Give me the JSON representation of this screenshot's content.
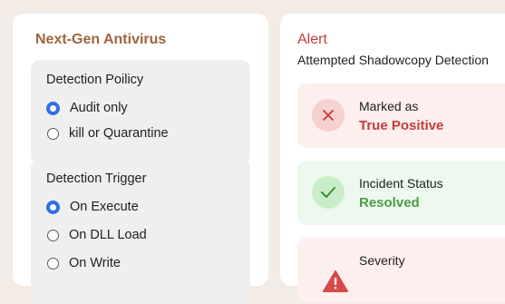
{
  "antivirus": {
    "title": "Next-Gen Antivirus",
    "policy": {
      "title": "Detection Poilicy",
      "options": [
        {
          "label": "Audit only",
          "selected": true
        },
        {
          "label": "kill or Quarantine",
          "selected": false
        }
      ]
    },
    "trigger": {
      "title": "Detection Trigger",
      "options": [
        {
          "label": "On Execute",
          "selected": true
        },
        {
          "label": "On DLL Load",
          "selected": false
        },
        {
          "label": "On Write",
          "selected": false
        }
      ]
    }
  },
  "alert": {
    "title": "Alert",
    "subtitle": "Attempted Shadowcopy Detection",
    "cards": [
      {
        "label": "Marked as",
        "value": "True Positive",
        "icon": "x-icon",
        "tone": "red"
      },
      {
        "label": "Incident Status",
        "value": "Resolved",
        "icon": "check-icon",
        "tone": "green"
      },
      {
        "label": "Severity",
        "value": "",
        "icon": "warning-icon",
        "tone": "red"
      }
    ]
  },
  "colors": {
    "background": "#f3ebe5",
    "accent_brown": "#a0643c",
    "radio_blue": "#2f6fe4",
    "alert_red": "#c63b3b",
    "success_green": "#4f9a45"
  }
}
